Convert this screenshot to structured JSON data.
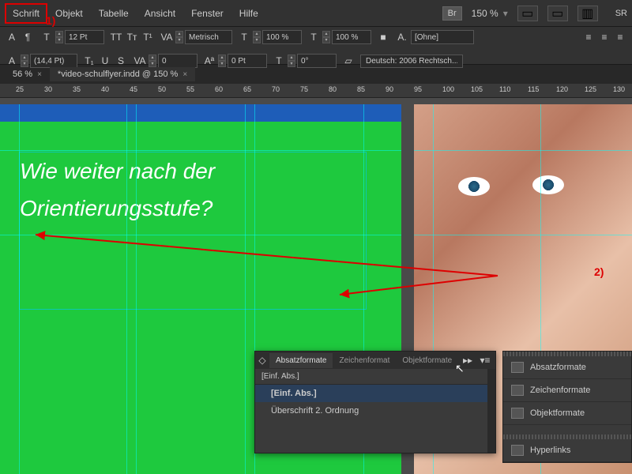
{
  "menubar": {
    "items": [
      "Schrift",
      "Objekt",
      "Tabelle",
      "Ansicht",
      "Fenster",
      "Hilfe"
    ],
    "br": "Br",
    "zoom": "150 %",
    "sr": "SR"
  },
  "toolbar": {
    "font_size": "12 Pt",
    "leading": "(14,4 Pt)",
    "kerning_mode": "Metrisch",
    "tracking": "0",
    "scale_h": "100 %",
    "scale_v": "100 %",
    "baseline": "0 Pt",
    "skew": "0°",
    "char_style": "[Ohne]",
    "language": "Deutsch: 2006 Rechtsch..."
  },
  "tabs": {
    "zoom_tab": "56 %",
    "doc": "*video-schulflyer.indd @ 150 %"
  },
  "ruler": [
    "25",
    "30",
    "35",
    "40",
    "45",
    "50",
    "55",
    "60",
    "65",
    "70",
    "75",
    "80",
    "85",
    "90",
    "95",
    "100",
    "105",
    "110",
    "115",
    "120",
    "125",
    "130"
  ],
  "headline": {
    "line1": "Wie weiter nach der",
    "line2": "Orientierungsstufe?"
  },
  "panel": {
    "tabs": [
      "Absatzformate",
      "Zeichenformat",
      "Objektformate"
    ],
    "header": "[Einf. Abs.]",
    "items": [
      "[Einf. Abs.]",
      "Überschrift 2. Ordnung"
    ]
  },
  "side_panel": {
    "items": [
      "Absatzformate",
      "Zeichenformate",
      "Objektformate",
      "Hyperlinks"
    ]
  },
  "annotations": {
    "a1": "1)",
    "a2": "2)"
  }
}
